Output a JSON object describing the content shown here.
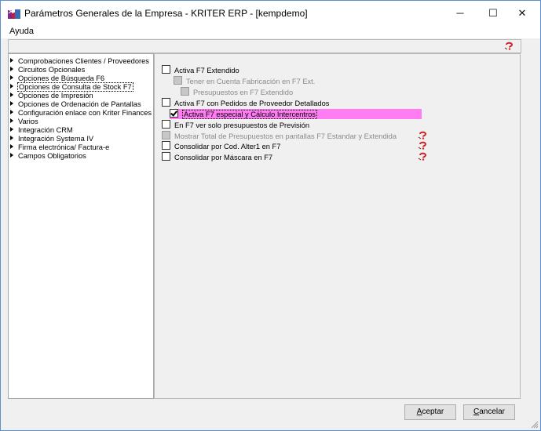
{
  "window": {
    "title": "Parámetros Generales de la Empresa - KRITER ERP - [kempdemo]",
    "app_icon": "kriter-app-icon",
    "controls": {
      "minimize": "─",
      "maximize": "☐",
      "close": "✕"
    }
  },
  "menu": {
    "items": [
      "Ayuda"
    ]
  },
  "toolbar": {
    "help_icon": "help-icon"
  },
  "nav": {
    "items": [
      {
        "label": "Comprobaciones Clientes / Proveedores"
      },
      {
        "label": "Circuitos Opcionales"
      },
      {
        "label": "Opciones de Búsqueda F6"
      },
      {
        "label": "Opciones de Consulta de Stock F7",
        "selected": true
      },
      {
        "label": "Opciones de Impresión"
      },
      {
        "label": "Opciones de Ordenación de Pantallas"
      },
      {
        "label": "Configuración enlace con Kriter Finances"
      },
      {
        "label": "Varios"
      },
      {
        "label": "Integración CRM"
      },
      {
        "label": "Integración Systema IV"
      },
      {
        "label": "Firma electrónica/ Factura-e"
      },
      {
        "label": "Campos Obligatorios"
      }
    ]
  },
  "options": [
    {
      "label": "Activa F7 Extendido",
      "checked": false,
      "enabled": true
    },
    {
      "label": "Tener en Cuenta Fabricación en F7 Ext.",
      "checked": false,
      "enabled": false
    },
    {
      "label": "Presupuestos en F7 Extendido",
      "checked": false,
      "enabled": false
    },
    {
      "label": "Activa F7 con Pedidos de Proveedor Detallados",
      "checked": false,
      "enabled": true
    },
    {
      "label": "Activa F7 especial y Cálculo Intercentros",
      "checked": true,
      "enabled": true,
      "highlighted": true
    },
    {
      "label": "En F7 ver solo presupuestos de Previsión",
      "checked": false,
      "enabled": true
    },
    {
      "label": "Mostrar Total de Presupuestos en pantallas F7 Estandar y Extendida",
      "checked": false,
      "enabled": false,
      "help": true
    },
    {
      "label": "Consolidar por Cod. Alter1 en F7",
      "checked": false,
      "enabled": true,
      "help": true
    },
    {
      "label": "Consolidar por  Máscara en F7",
      "checked": false,
      "enabled": true,
      "help": true
    }
  ],
  "buttons": {
    "accept": {
      "accel": "A",
      "rest": "ceptar"
    },
    "cancel": {
      "accel": "C",
      "rest": "ancelar"
    }
  },
  "colors": {
    "highlight": "#ff7cf2",
    "help_icon_red": "#d0232a"
  }
}
